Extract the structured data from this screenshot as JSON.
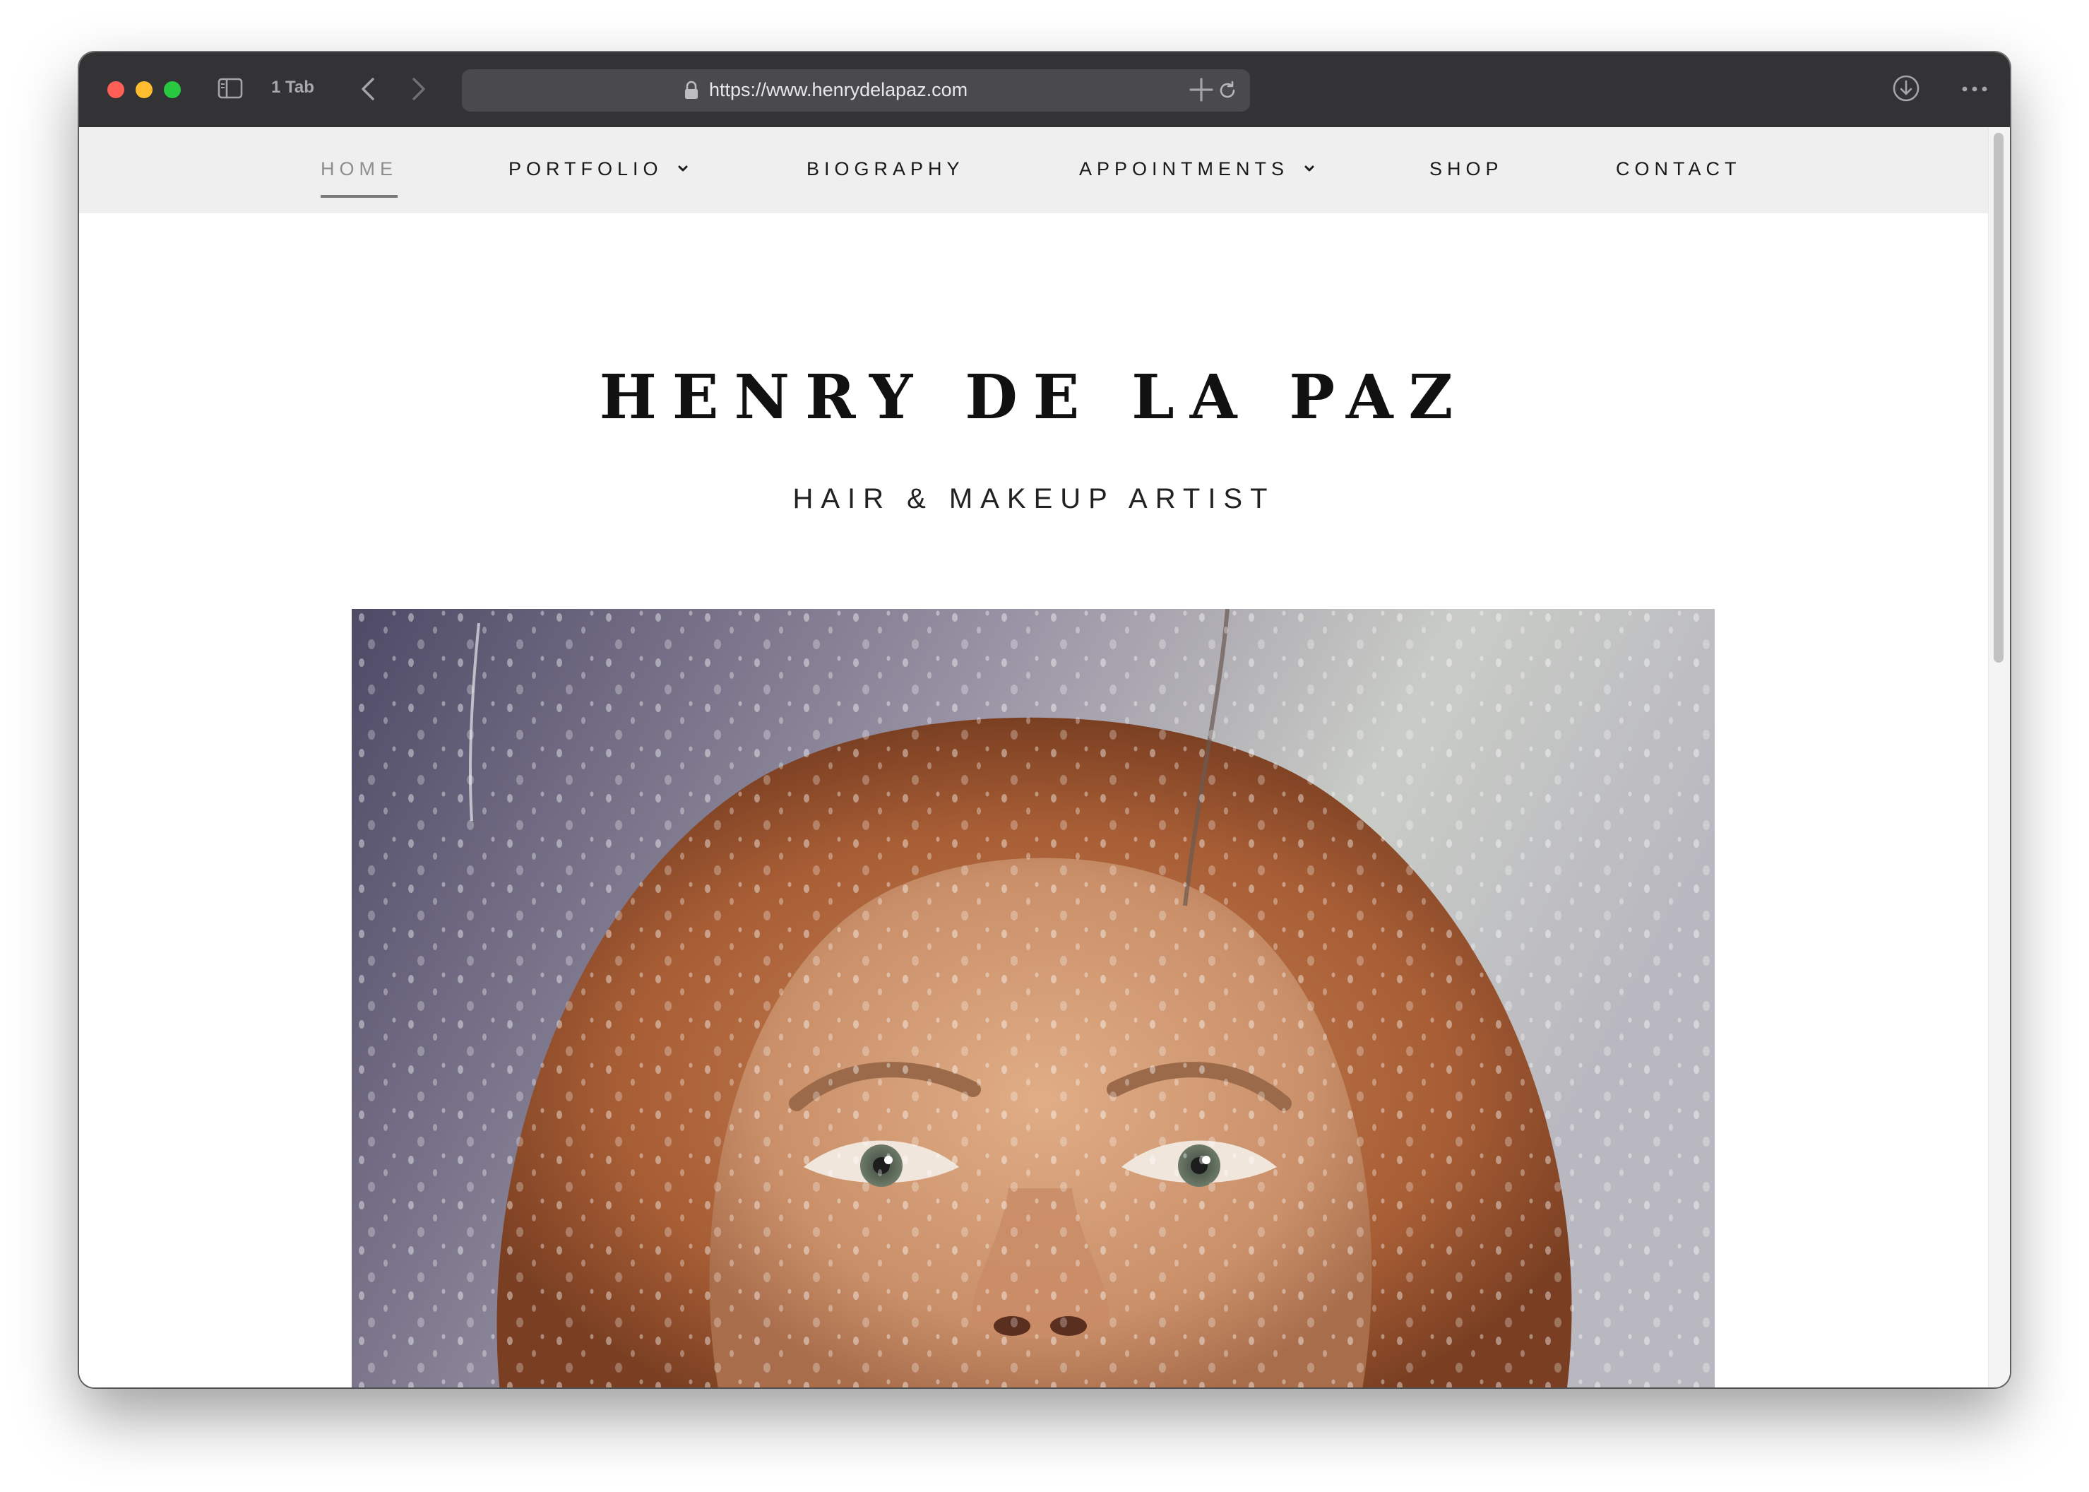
{
  "browser": {
    "tab_count_label": "1 Tab",
    "url": "https://www.henrydelapaz.com"
  },
  "nav": {
    "items": [
      {
        "label": "HOME",
        "active": true,
        "has_dropdown": false
      },
      {
        "label": "PORTFOLIO",
        "active": false,
        "has_dropdown": true
      },
      {
        "label": "BIOGRAPHY",
        "active": false,
        "has_dropdown": false
      },
      {
        "label": "APPOINTMENTS",
        "active": false,
        "has_dropdown": true
      },
      {
        "label": "SHOP",
        "active": false,
        "has_dropdown": false
      },
      {
        "label": "CONTACT",
        "active": false,
        "has_dropdown": false
      }
    ]
  },
  "site": {
    "title": "HENRY DE LA PAZ",
    "subtitle": "HAIR & MAKEUP ARTIST"
  },
  "colors": {
    "titlebar": "#333335",
    "navbar_bg": "#efefef",
    "active_nav": "#8f8f8f"
  },
  "icons": [
    "sidebar-icon",
    "back-chevron-icon",
    "forward-chevron-icon",
    "lock-icon",
    "reload-icon",
    "plus-icon",
    "download-icon",
    "more-icon",
    "chevron-down-icon"
  ]
}
